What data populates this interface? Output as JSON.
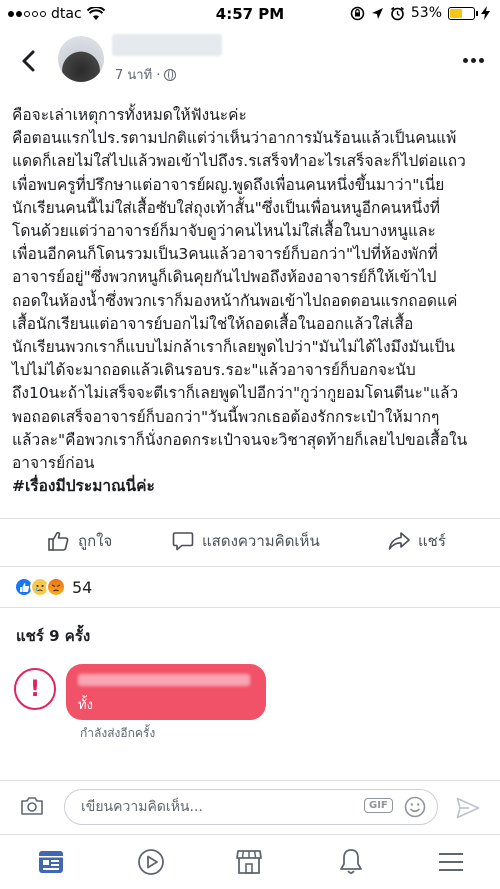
{
  "status_bar": {
    "carrier": "dtac",
    "time": "4:57 PM",
    "battery_percent": "53%",
    "battery_level": 0.53
  },
  "post": {
    "timestamp": "7 นาที ·",
    "body_lines": [
      "คือจะเล่าเหตุการทั้งหมดให้ฟังนะค่ะ",
      "คือตอนแรกไปร.รตามปกติแต่ว่าเห็นว่าอาการมันร้อนแล้วเป็นคนแพ้",
      "แดดก็เลยไม่ใส่ไปแล้วพอเข้าไปถึงร.รเสร็จทำอะไรเสร็จละก็ไปต่อแถว",
      "เพื่อพบครูที่ปรึกษาแต่อาจารย์ผญ.พูดถึงเพื่อนคนหนึ่งขึ้นมาว่า\"เนี่ย",
      "นักเรียนคนนี้ไม่ใส่เสื้อซับใส่ถุงเท้าสั้น\"ซึ่งเป็นเพื่อนหนูอีกคนหนึ่งที่",
      "โดนด้วยแต่ว่าอาจารย์ก็มาจับดูว่าคนไหนไม่ใส่เสื้อในบางหนูและ",
      "เพื่อนอีกคนก็โดนรวมเป็น3คนแล้วอาจารย์ก็บอกว่า\"ไปที่ห้องพักที่",
      "อาจารย์อยู่\"ซึ่งพวกหนูก็เดินคุยกันไปพอถึงห้องอาจารย์ก็ให้เข้าไป",
      "ถอดในห้องน้ำซึ่งพวกเราก็มองหน้ากันพอเข้าไปถอดตอนแรกถอดแค่",
      "เสื้อนักเรียนแต่อาจารย์บอกไม่ใช่ให้ถอดเสื้อในออกแล้วใส่เสื้อ",
      "นักเรียนพวกเราก็แบบไม่กล้าเราก็เลยพูดไปว่า\"มันไม่ได้ไงมึงมันเป็น",
      "ไปไม่ได้จะมาถอดแล้วเดินรอบร.รอะ\"แล้วอาจารย์ก็บอกจะนับ",
      "ถึง10นะถ้าไม่เสร็จจะตีเราก็เลยพูดไปอีกว่า\"กูว่ากูยอมโดนตีนะ\"แล้ว",
      "พอถอดเสร็จอาจารย์ก็บอกว่า\"วันนี้พวกเธอต้องรักกระเป๋าให้มากๆ",
      "แล้วละ\"คือพวกเราก็นั่งกอดกระเป๋าจนจะวิชาสุดท้ายก็เลยไปขอเสื้อใน",
      "อาจารย์ก่อน"
    ],
    "hashtag": "#เรื่องมีประมาณนี่ค่ะ"
  },
  "actions": {
    "like": "ถูกใจ",
    "comment": "แสดงความคิดเห็น",
    "share": "แชร์"
  },
  "reactions": {
    "count": "54",
    "types": [
      "like",
      "sad",
      "angry"
    ]
  },
  "shares_text": "แชร์ 9 ครั้ง",
  "comment": {
    "error_glyph": "!",
    "text_fragment": "ทั้ง",
    "status": "กำลังส่งอีกครั้ง"
  },
  "composer": {
    "placeholder": "เขียนความคิดเห็น...",
    "gif_label": "GIF"
  },
  "colors": {
    "accent": "#1877f2",
    "comment_bubble": "#f25268",
    "error": "#e0245e",
    "battery_fill": "#f5c518"
  }
}
